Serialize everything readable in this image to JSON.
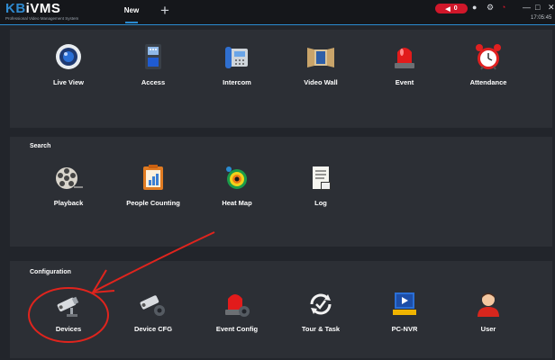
{
  "app": {
    "logo": "KBiVMS",
    "logo_kb": "KB",
    "logo_ivms": "iVMS",
    "subtitle": "Professional Video Management System",
    "time": "17:05:45"
  },
  "tabs": [
    {
      "label": "New",
      "active": true
    }
  ],
  "alarm": {
    "count": "0",
    "color": "#d0172a"
  },
  "accent": "#2a8bd1",
  "top_items": [
    {
      "label": "Live View",
      "icon": "live-view-icon"
    },
    {
      "label": "Access",
      "icon": "access-icon"
    },
    {
      "label": "Intercom",
      "icon": "intercom-icon"
    },
    {
      "label": "Video Wall",
      "icon": "video-wall-icon"
    },
    {
      "label": "Event",
      "icon": "event-icon"
    },
    {
      "label": "Attendance",
      "icon": "attendance-icon"
    }
  ],
  "search": {
    "title": "Search",
    "items": [
      {
        "label": "Playback",
        "icon": "playback-icon"
      },
      {
        "label": "People Counting",
        "icon": "people-counting-icon"
      },
      {
        "label": "Heat Map",
        "icon": "heat-map-icon"
      },
      {
        "label": "Log",
        "icon": "log-icon"
      }
    ]
  },
  "configuration": {
    "title": "Configuration",
    "items": [
      {
        "label": "Devices",
        "icon": "devices-icon"
      },
      {
        "label": "Device CFG",
        "icon": "device-cfg-icon"
      },
      {
        "label": "Event Config",
        "icon": "event-config-icon"
      },
      {
        "label": "Tour & Task",
        "icon": "tour-task-icon"
      },
      {
        "label": "PC-NVR",
        "icon": "pc-nvr-icon"
      },
      {
        "label": "User",
        "icon": "user-icon"
      }
    ]
  },
  "annotation": {
    "color": "#e0241d"
  }
}
